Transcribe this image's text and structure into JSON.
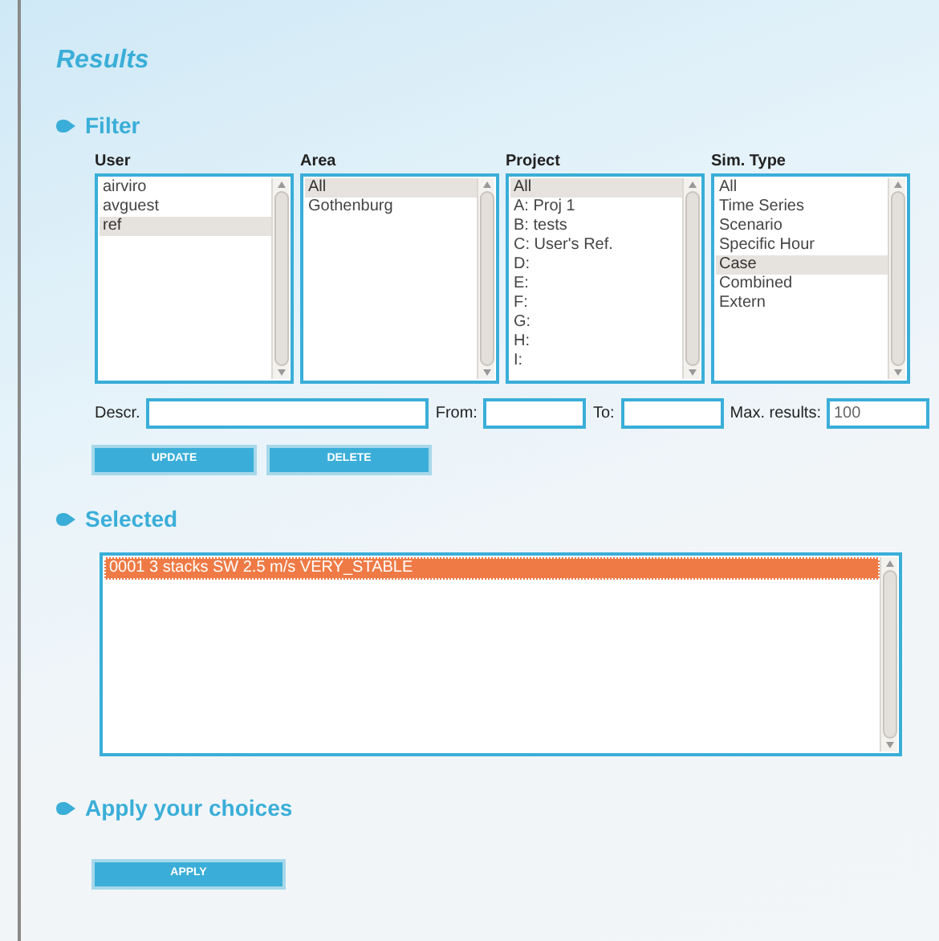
{
  "title": "Results",
  "filter": {
    "heading": "Filter",
    "lists": [
      {
        "label": "User",
        "items": [
          {
            "text": "airviro",
            "selected": false
          },
          {
            "text": "avguest",
            "selected": false
          },
          {
            "text": "ref",
            "selected": true
          }
        ]
      },
      {
        "label": "Area",
        "items": [
          {
            "text": "All",
            "selected": true
          },
          {
            "text": "Gothenburg",
            "selected": false
          }
        ]
      },
      {
        "label": "Project",
        "items": [
          {
            "text": "All",
            "selected": true
          },
          {
            "text": "A: Proj 1",
            "selected": false
          },
          {
            "text": "B: tests",
            "selected": false
          },
          {
            "text": "C: User's Ref.",
            "selected": false
          },
          {
            "text": "D:",
            "selected": false
          },
          {
            "text": "E:",
            "selected": false
          },
          {
            "text": "F:",
            "selected": false
          },
          {
            "text": "G:",
            "selected": false
          },
          {
            "text": "H:",
            "selected": false
          },
          {
            "text": "I:",
            "selected": false
          }
        ]
      },
      {
        "label": "Sim. Type",
        "items": [
          {
            "text": "All",
            "selected": false
          },
          {
            "text": "Time Series",
            "selected": false
          },
          {
            "text": "Scenario",
            "selected": false
          },
          {
            "text": "Specific Hour",
            "selected": false
          },
          {
            "text": "Case",
            "selected": true
          },
          {
            "text": "Combined",
            "selected": false
          },
          {
            "text": "Extern",
            "selected": false
          }
        ]
      }
    ],
    "fields": [
      {
        "label": "Descr."
      },
      {
        "label": "From:"
      },
      {
        "label": "To:"
      },
      {
        "label": "Max. results:",
        "value": "100"
      }
    ],
    "buttons": [
      "UPDATE",
      "DELETE"
    ]
  },
  "selected": {
    "heading": "Selected",
    "items": [
      {
        "text": "0001 3 stacks SW 2.5 m/s VERY_STABLE",
        "selected": true
      }
    ]
  },
  "apply": {
    "heading": "Apply your choices",
    "button": "APPLY"
  }
}
